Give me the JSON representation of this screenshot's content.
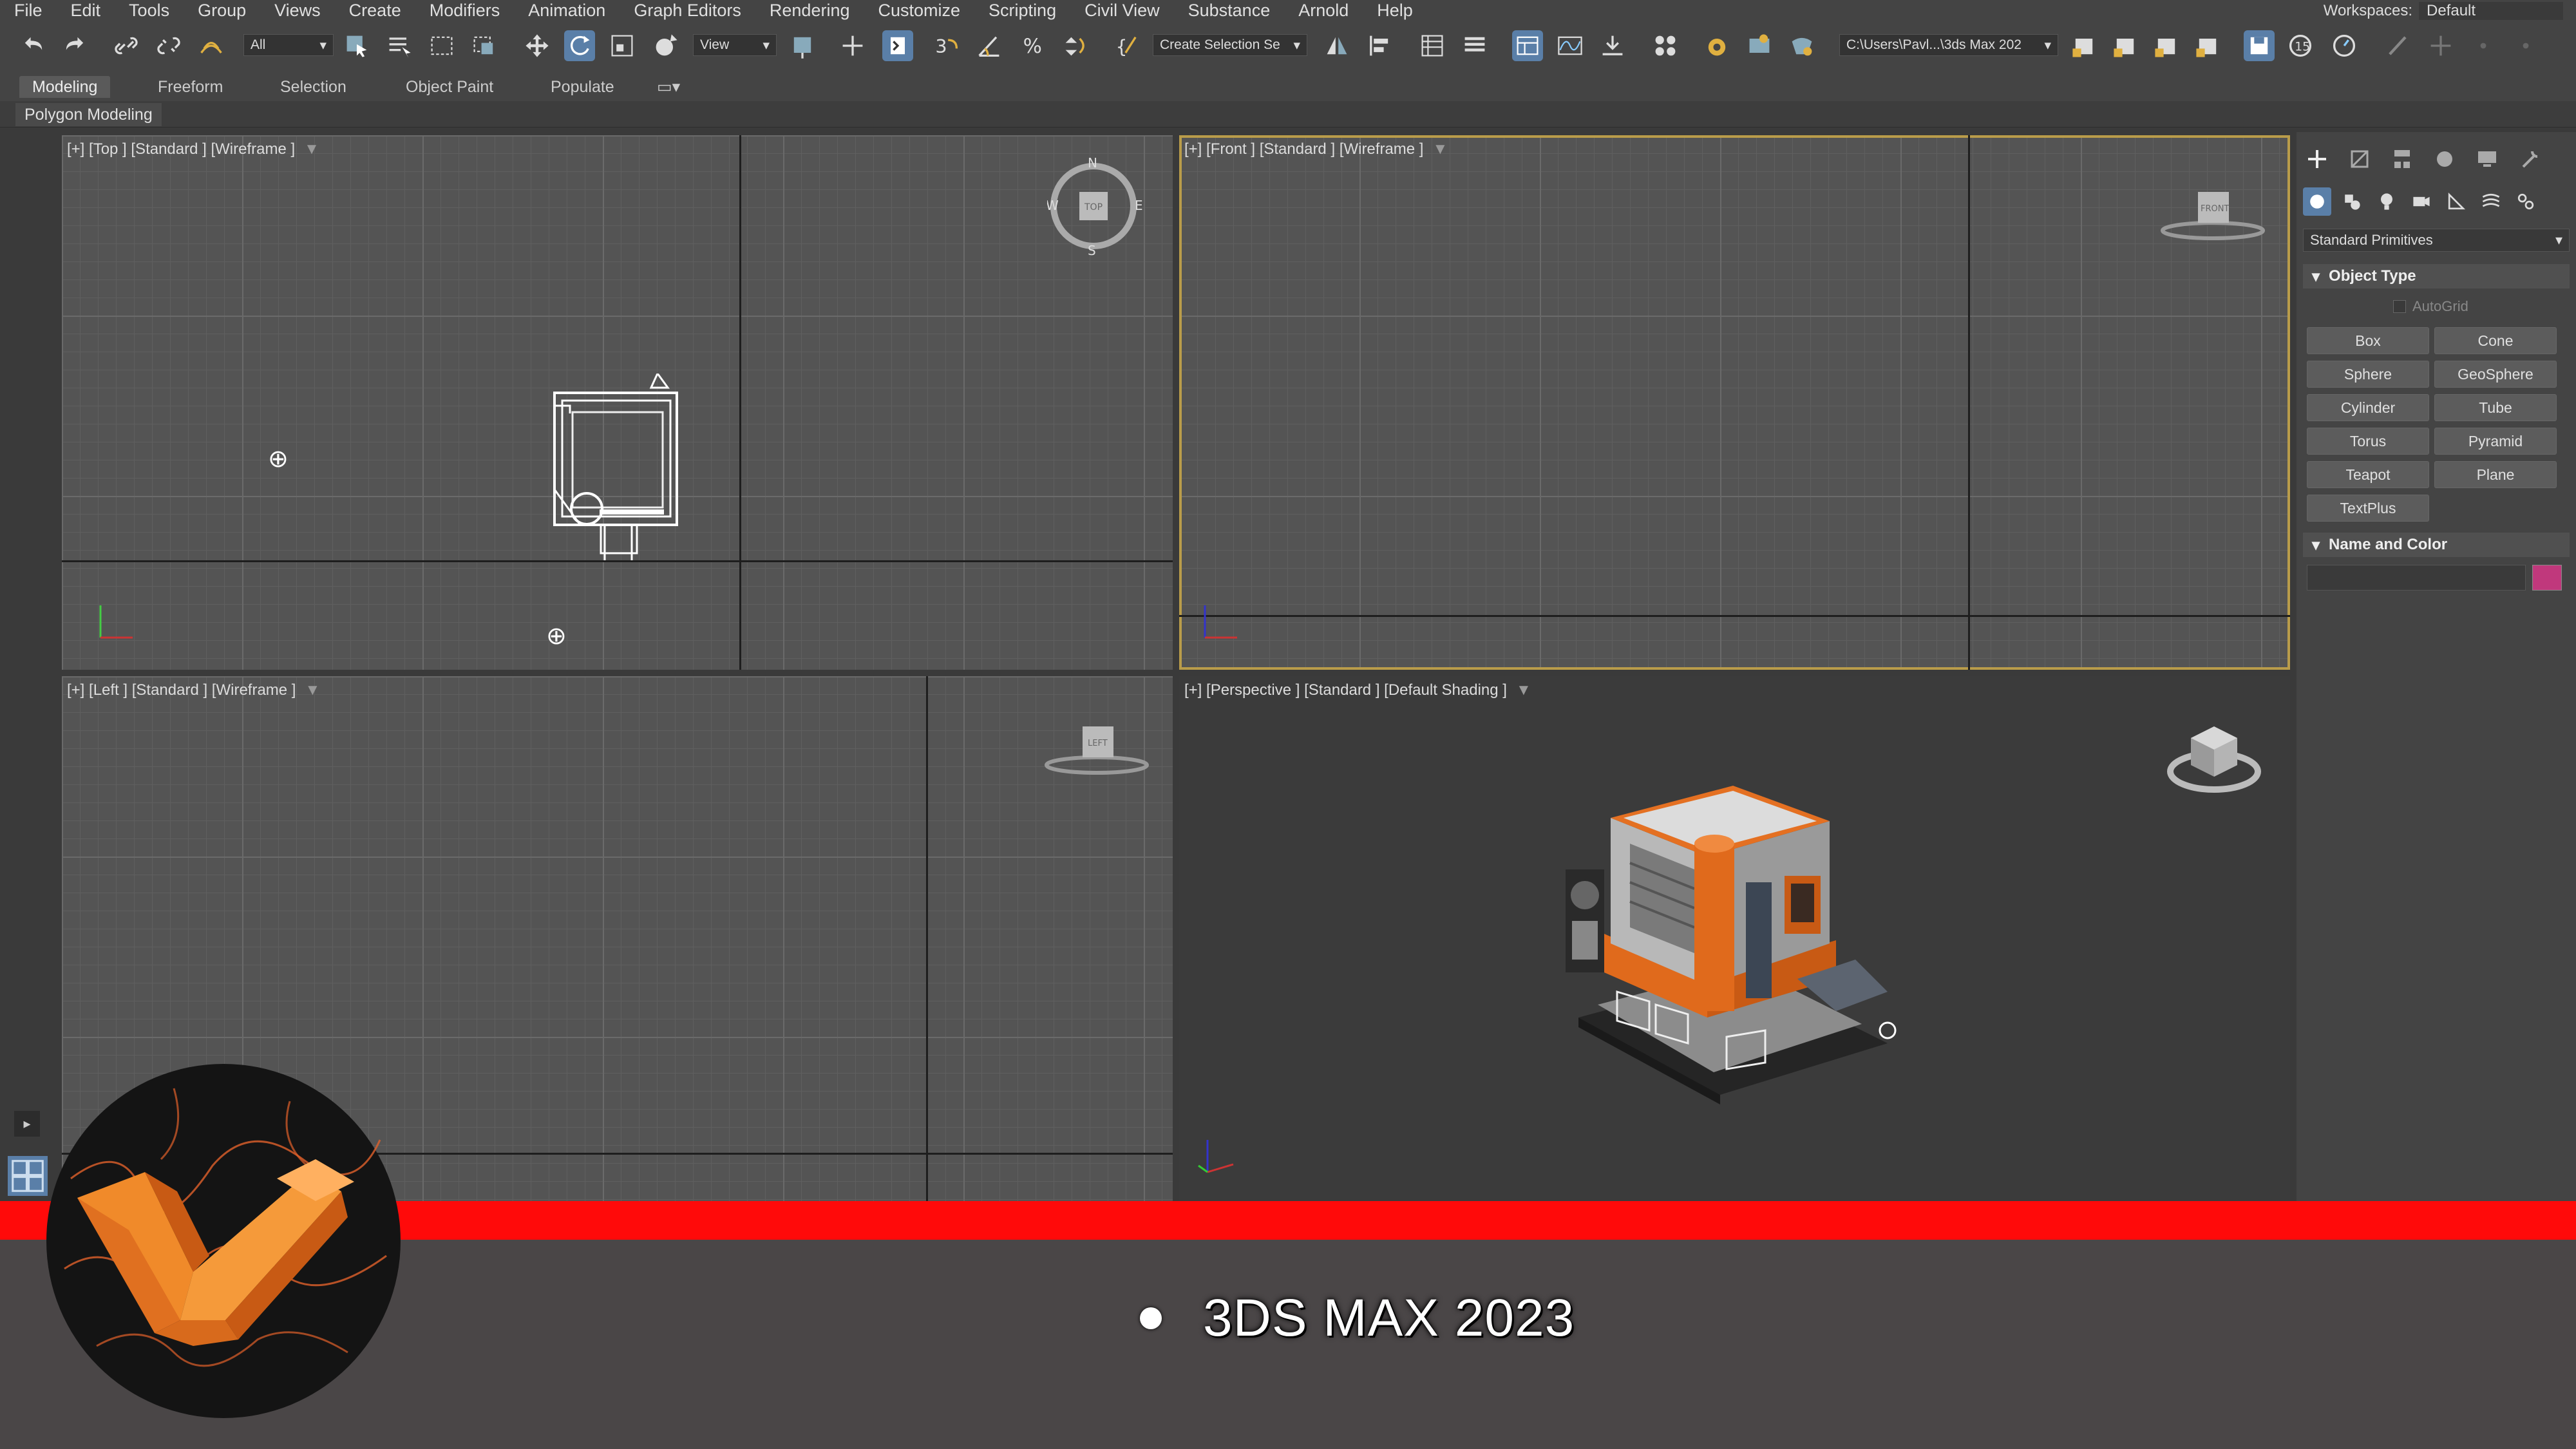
{
  "menu": [
    "File",
    "Edit",
    "Tools",
    "Group",
    "Views",
    "Create",
    "Modifiers",
    "Animation",
    "Graph Editors",
    "Rendering",
    "Customize",
    "Scripting",
    "Civil View",
    "Substance",
    "Arnold",
    "Help"
  ],
  "workspaces": {
    "label": "Workspaces:",
    "value": "Default"
  },
  "toolbar": {
    "selection_filter": "All",
    "ref_coord": "View",
    "named_selection": "Create Selection Se",
    "project_path": "C:\\Users\\Pavl...\\3ds Max 202"
  },
  "ribbon": {
    "tabs": [
      "Modeling",
      "Freeform",
      "Selection",
      "Object Paint",
      "Populate"
    ],
    "active": "Modeling",
    "subtab": "Polygon Modeling"
  },
  "viewports": {
    "top": {
      "label": "[+] [Top ] [Standard ] [Wireframe ]"
    },
    "front": {
      "label": "[+] [Front ] [Standard ] [Wireframe ]"
    },
    "left": {
      "label": "[+] [Left ] [Standard ] [Wireframe ]"
    },
    "perspective": {
      "label": "[+] [Perspective ] [Standard ] [Default Shading ]"
    }
  },
  "viewcube": {
    "top_face": "TOP",
    "front_face": "FRONT",
    "left_face": "LEFT",
    "compass": [
      "N",
      "E",
      "S",
      "W"
    ]
  },
  "command_panel": {
    "category": "Standard Primitives",
    "object_type": {
      "title": "Object Type",
      "autogrid": "AutoGrid",
      "buttons": [
        "Box",
        "Cone",
        "Sphere",
        "GeoSphere",
        "Cylinder",
        "Tube",
        "Torus",
        "Pyramid",
        "Teapot",
        "Plane",
        "TextPlus"
      ]
    },
    "name_color": {
      "title": "Name and Color",
      "name_value": "",
      "color": "#c0387c"
    }
  },
  "overlay": {
    "caption": "3DS MAX 2023",
    "band_color": "#ff0a0a"
  }
}
